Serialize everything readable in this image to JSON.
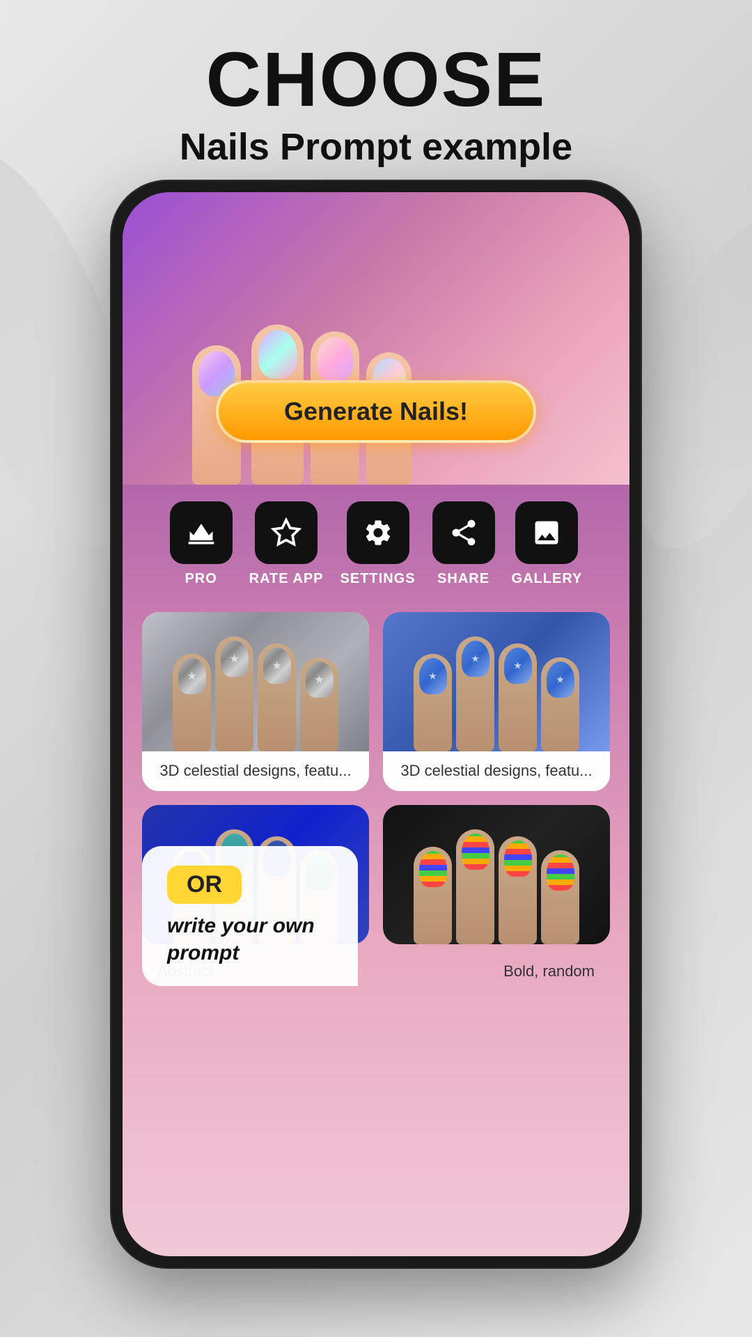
{
  "page": {
    "title": "CHOOSE",
    "subtitle": "Nails Prompt example"
  },
  "phone": {
    "generate_button": "Generate Nails!",
    "action_items": [
      {
        "id": "pro",
        "label": "PRO",
        "icon": "crown"
      },
      {
        "id": "rate_app",
        "label": "RATE APP",
        "icon": "star"
      },
      {
        "id": "settings",
        "label": "SETTINGS",
        "icon": "gear"
      },
      {
        "id": "share",
        "label": "SHARE",
        "icon": "share"
      },
      {
        "id": "gallery",
        "label": "GALLERY",
        "icon": "image"
      }
    ],
    "gallery_items": [
      {
        "id": "item1",
        "caption": "3D celestial designs, featu...",
        "style": "glitter-silver"
      },
      {
        "id": "item2",
        "caption": "3D celestial designs, featu...",
        "style": "blue-cat"
      },
      {
        "id": "item3",
        "caption": "Abstract",
        "style": "blue-matte"
      },
      {
        "id": "item4",
        "caption": "Bold, random",
        "style": "colorful-stripes"
      }
    ]
  },
  "overlay": {
    "or_label": "OR",
    "prompt_text": "write your own prompt"
  },
  "colors": {
    "accent_yellow": "#ffd633",
    "generate_gradient_top": "#ffcc44",
    "generate_gradient_bottom": "#ff9900",
    "phone_bg": "#1a1a1a",
    "text_dark": "#111111"
  }
}
